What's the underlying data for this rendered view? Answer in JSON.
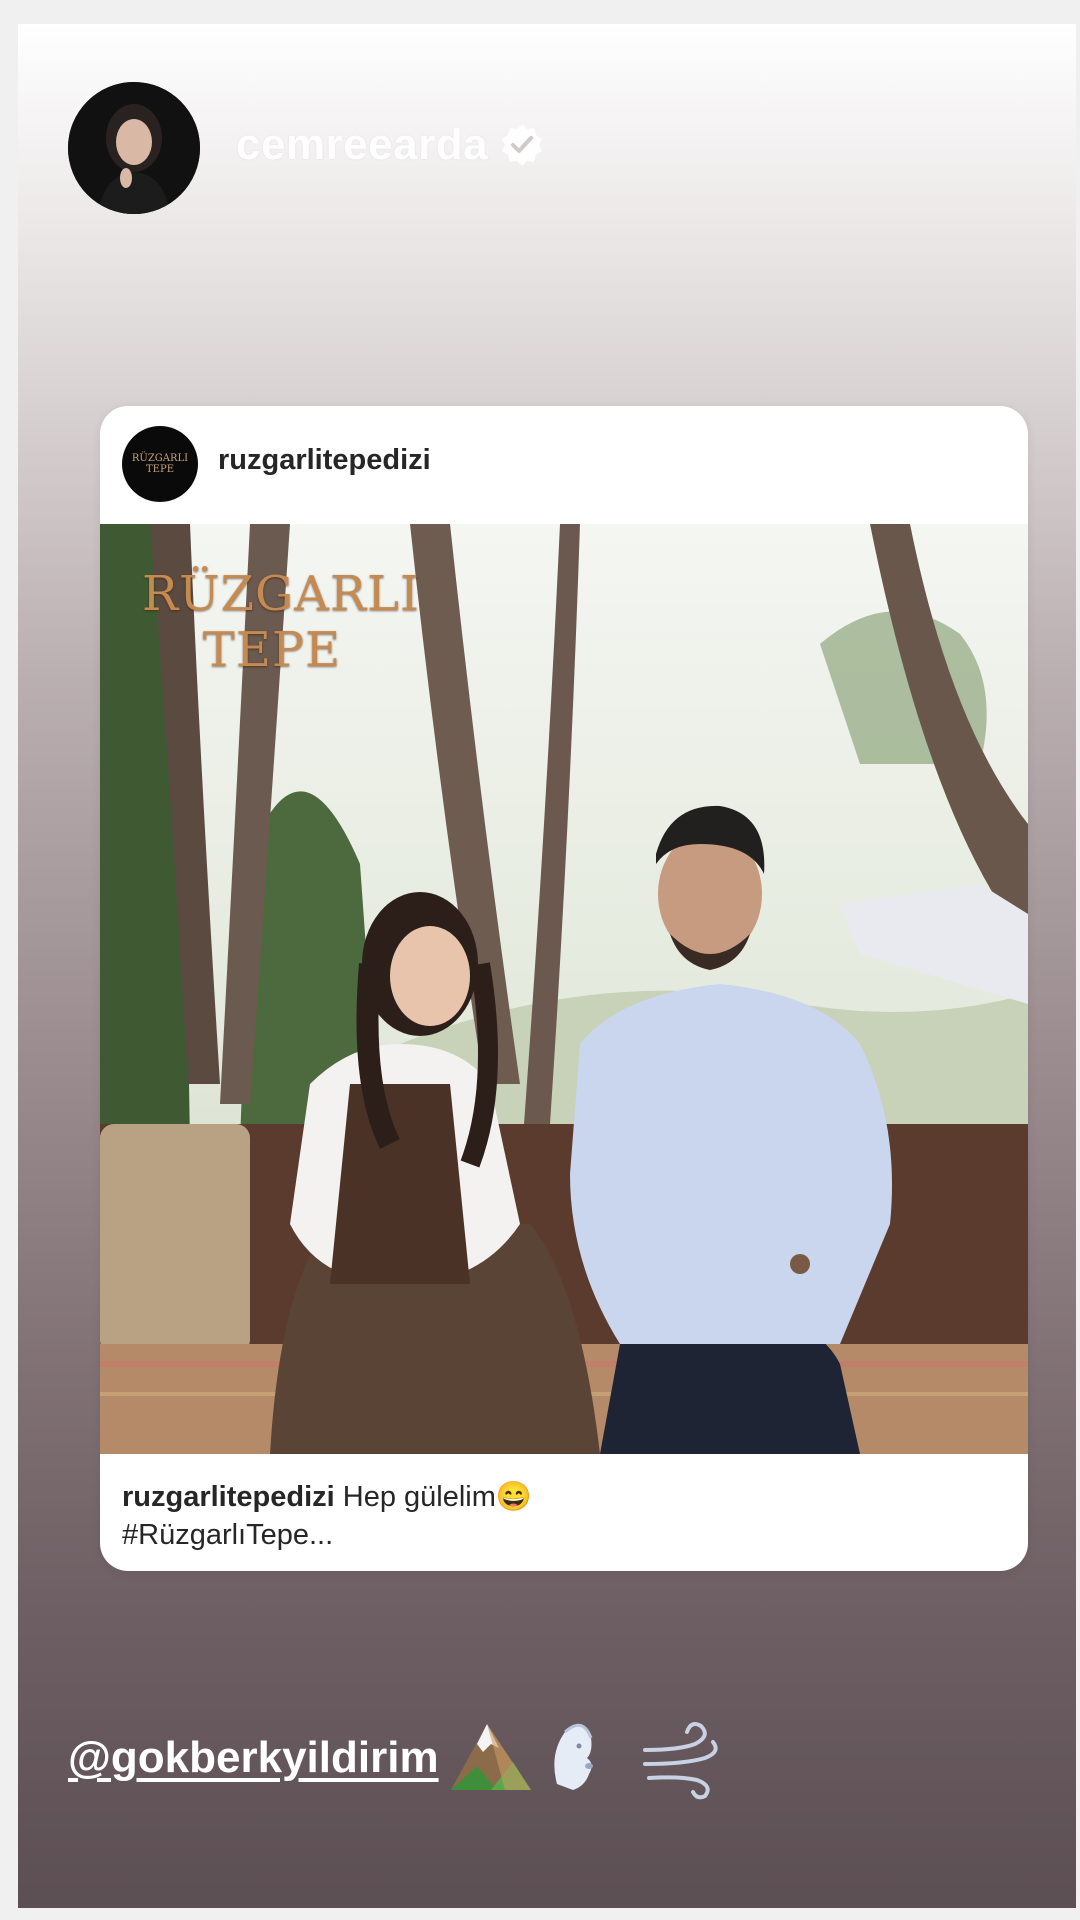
{
  "story": {
    "owner": {
      "username": "cemreearda",
      "verified": true
    },
    "mention": "@gokberkyildirim",
    "emojis": [
      "mountain-icon",
      "face-blowing-wind-icon",
      "dash-icon"
    ]
  },
  "post": {
    "username": "ruzgarlitepedizi",
    "avatar_text": [
      "RÜZGARLI",
      "TEPE"
    ],
    "image_logo": [
      "RÜZGARLI",
      "TEPE"
    ],
    "caption_user": "ruzgarlitepedizi",
    "caption_text": "Hep gülelim😄",
    "caption_more": "#RüzgarlıTepe..."
  }
}
